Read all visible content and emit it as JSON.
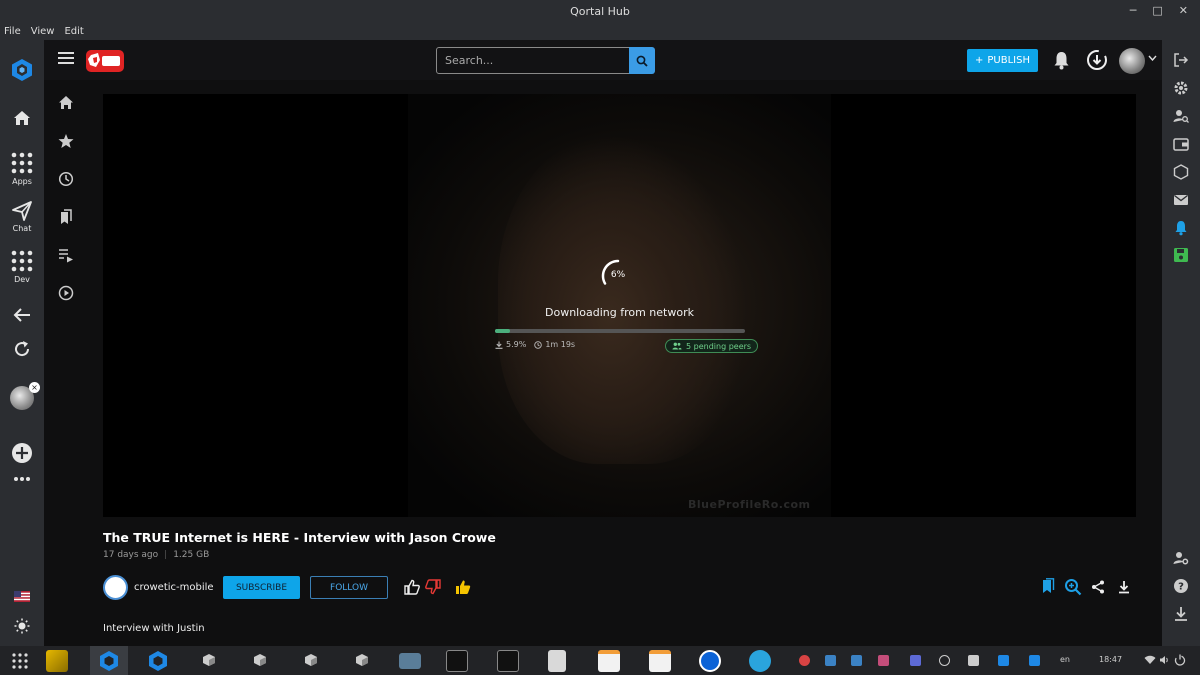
{
  "window": {
    "title": "Qortal Hub"
  },
  "menubar": {
    "items": [
      "File",
      "View",
      "Edit"
    ]
  },
  "rail": {
    "apps_label": "Apps",
    "chat_label": "Chat",
    "dev_label": "Dev"
  },
  "header": {
    "search_placeholder": "Search...",
    "publish_label": "PUBLISH"
  },
  "player": {
    "progress_percent_label": "6%",
    "progress_fraction": 0.059,
    "status_text": "Downloading from network",
    "downloaded_label": "5.9%",
    "eta_label": "1m 19s",
    "peers_label": "5 pending peers"
  },
  "video": {
    "title": "The TRUE Internet is HERE - Interview with Jason Crowe",
    "age": "17 days ago",
    "size": "1.25 GB",
    "channel": "crowetic-mobile",
    "subscribe_label": "SUBSCRIBE",
    "follow_label": "FOLLOW",
    "description": "Interview with Justin"
  },
  "taskbar": {
    "language": "en",
    "time": "18:47"
  },
  "colors": {
    "accent": "#0ea5e9",
    "progress": "#4caf7d",
    "danger": "#e53935",
    "like": "#f5c400"
  }
}
